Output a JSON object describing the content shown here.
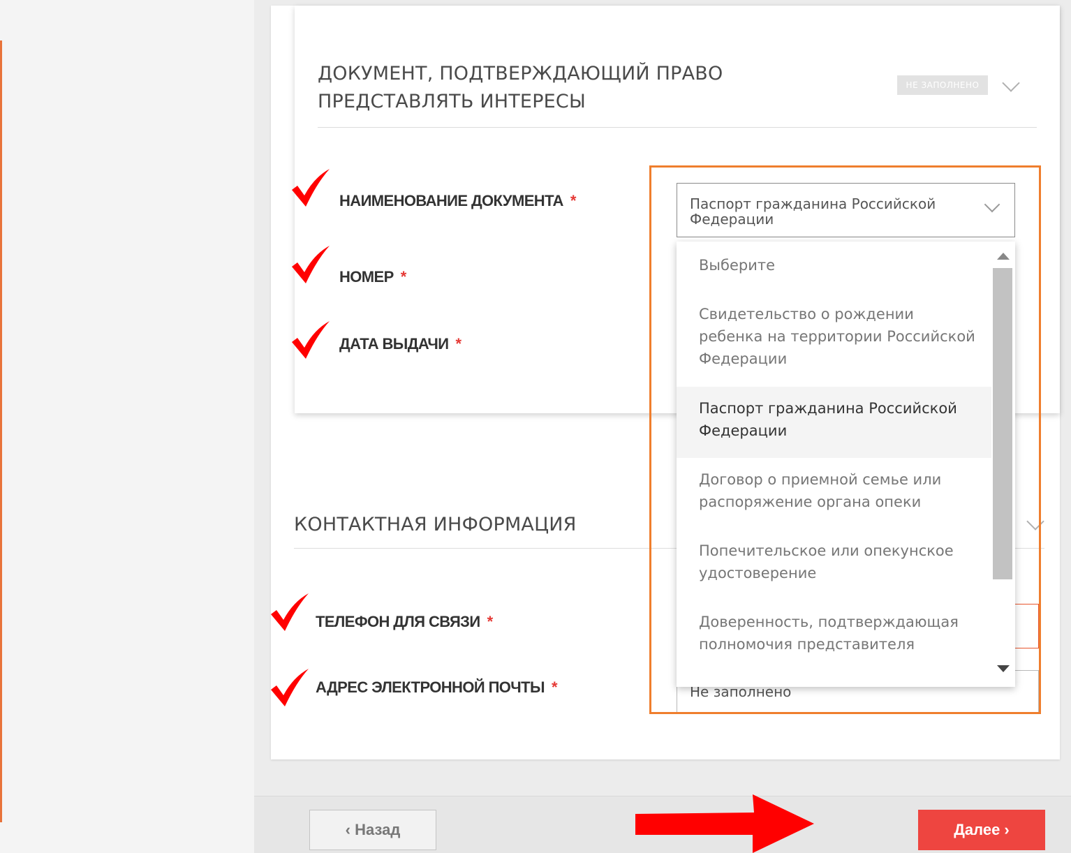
{
  "doc_section": {
    "title": "ДОКУМЕНТ, ПОДТВЕРЖДАЮЩИЙ ПРАВО ПРЕДСТАВЛЯТЬ ИНТЕРЕСЫ",
    "status": "НЕ ЗАПОЛНЕНО",
    "fields": {
      "doc_name_label": "НАИМЕНОВАНИЕ ДОКУМЕНТА",
      "number_label": "НОМЕР",
      "date_label": "ДАТА ВЫДАЧИ",
      "required_mark": "*"
    },
    "select": {
      "value": "Паспорт гражданина Российской Федерации",
      "options": [
        "Выберите",
        "Свидетельство о рождении ребенка на территории Российской Федерации",
        "Паспорт гражданина Российской Федерации",
        "Договор о приемной семье или распоряжение органа опеки",
        "Попечительское или опекунское удостоверение",
        "Доверенность, подтверждающая полномочия представителя"
      ],
      "selected_index": 2
    }
  },
  "contact_section": {
    "title": "КОНТАКТНАЯ ИНФОРМАЦИЯ",
    "phone_label": "ТЕЛЕФОН ДЛЯ СВЯЗИ",
    "email_label": "АДРЕС ЭЛЕКТРОННОЙ ПОЧТЫ",
    "email_value": "Не заполнено",
    "required_mark": "*"
  },
  "footer": {
    "back_label": "‹ Назад",
    "next_label": "Далее ›"
  },
  "colors": {
    "accent_orange": "#ef7e2d",
    "next_button": "#ee4540",
    "required_star": "#e53935",
    "annotation_red": "#ff0000"
  }
}
